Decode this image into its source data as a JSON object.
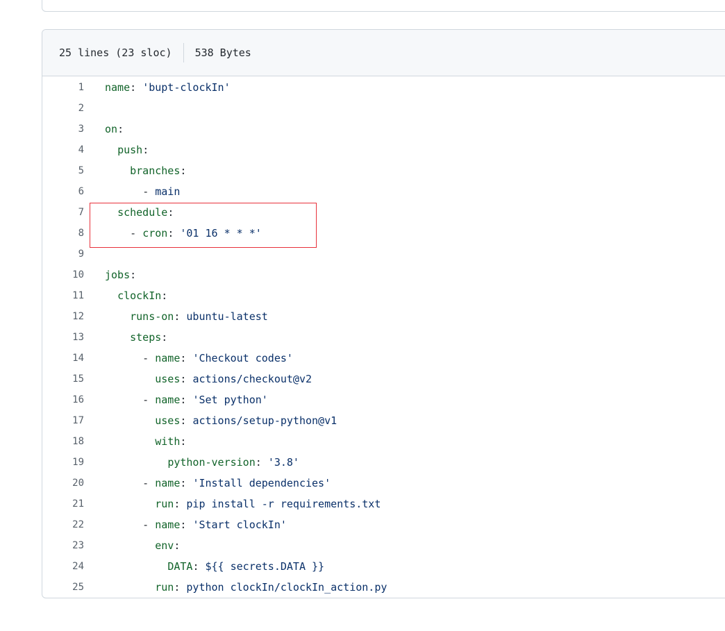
{
  "file_header": {
    "lines_info": "25 lines (23 sloc)",
    "size_info": "538 Bytes"
  },
  "code_lines": [
    {
      "n": "1",
      "indent": "",
      "key": "name",
      "sep": ": ",
      "value": "'bupt-clockIn'"
    },
    {
      "n": "2",
      "indent": "",
      "key": "",
      "sep": "",
      "value": ""
    },
    {
      "n": "3",
      "indent": "",
      "key": "on",
      "sep": ":",
      "value": ""
    },
    {
      "n": "4",
      "indent": "  ",
      "key": "push",
      "sep": ":",
      "value": ""
    },
    {
      "n": "5",
      "indent": "    ",
      "key": "branches",
      "sep": ":",
      "value": ""
    },
    {
      "n": "6",
      "indent": "      ",
      "key": "",
      "sep": "- ",
      "value": "main"
    },
    {
      "n": "7",
      "indent": "  ",
      "key": "schedule",
      "sep": ":",
      "value": ""
    },
    {
      "n": "8",
      "indent": "    - ",
      "key": "cron",
      "sep": ": ",
      "value": "'01 16 * * *'"
    },
    {
      "n": "9",
      "indent": "",
      "key": "",
      "sep": "",
      "value": ""
    },
    {
      "n": "10",
      "indent": "",
      "key": "jobs",
      "sep": ":",
      "value": ""
    },
    {
      "n": "11",
      "indent": "  ",
      "key": "clockIn",
      "sep": ":",
      "value": ""
    },
    {
      "n": "12",
      "indent": "    ",
      "key": "runs-on",
      "sep": ": ",
      "value": "ubuntu-latest"
    },
    {
      "n": "13",
      "indent": "    ",
      "key": "steps",
      "sep": ":",
      "value": ""
    },
    {
      "n": "14",
      "indent": "      - ",
      "key": "name",
      "sep": ": ",
      "value": "'Checkout codes'"
    },
    {
      "n": "15",
      "indent": "        ",
      "key": "uses",
      "sep": ": ",
      "value": "actions/checkout@v2"
    },
    {
      "n": "16",
      "indent": "      - ",
      "key": "name",
      "sep": ": ",
      "value": "'Set python'"
    },
    {
      "n": "17",
      "indent": "        ",
      "key": "uses",
      "sep": ": ",
      "value": "actions/setup-python@v1"
    },
    {
      "n": "18",
      "indent": "        ",
      "key": "with",
      "sep": ":",
      "value": ""
    },
    {
      "n": "19",
      "indent": "          ",
      "key": "python-version",
      "sep": ": ",
      "value": "'3.8'"
    },
    {
      "n": "20",
      "indent": "      - ",
      "key": "name",
      "sep": ": ",
      "value": "'Install dependencies'"
    },
    {
      "n": "21",
      "indent": "        ",
      "key": "run",
      "sep": ": ",
      "value": "pip install -r requirements.txt"
    },
    {
      "n": "22",
      "indent": "      - ",
      "key": "name",
      "sep": ": ",
      "value": "'Start clockIn'"
    },
    {
      "n": "23",
      "indent": "        ",
      "key": "env",
      "sep": ":",
      "value": ""
    },
    {
      "n": "24",
      "indent": "          ",
      "key": "DATA",
      "sep": ": ",
      "value": "${{ secrets.DATA }}"
    },
    {
      "n": "25",
      "indent": "        ",
      "key": "run",
      "sep": ": ",
      "value": "python clockIn/clockIn_action.py"
    }
  ],
  "colors": {
    "key": "#116329",
    "value": "#0a3069",
    "line_number": "#57606a",
    "highlight_border": "#e8303a",
    "header_bg": "#f6f8fa",
    "border": "#d0d7de"
  }
}
